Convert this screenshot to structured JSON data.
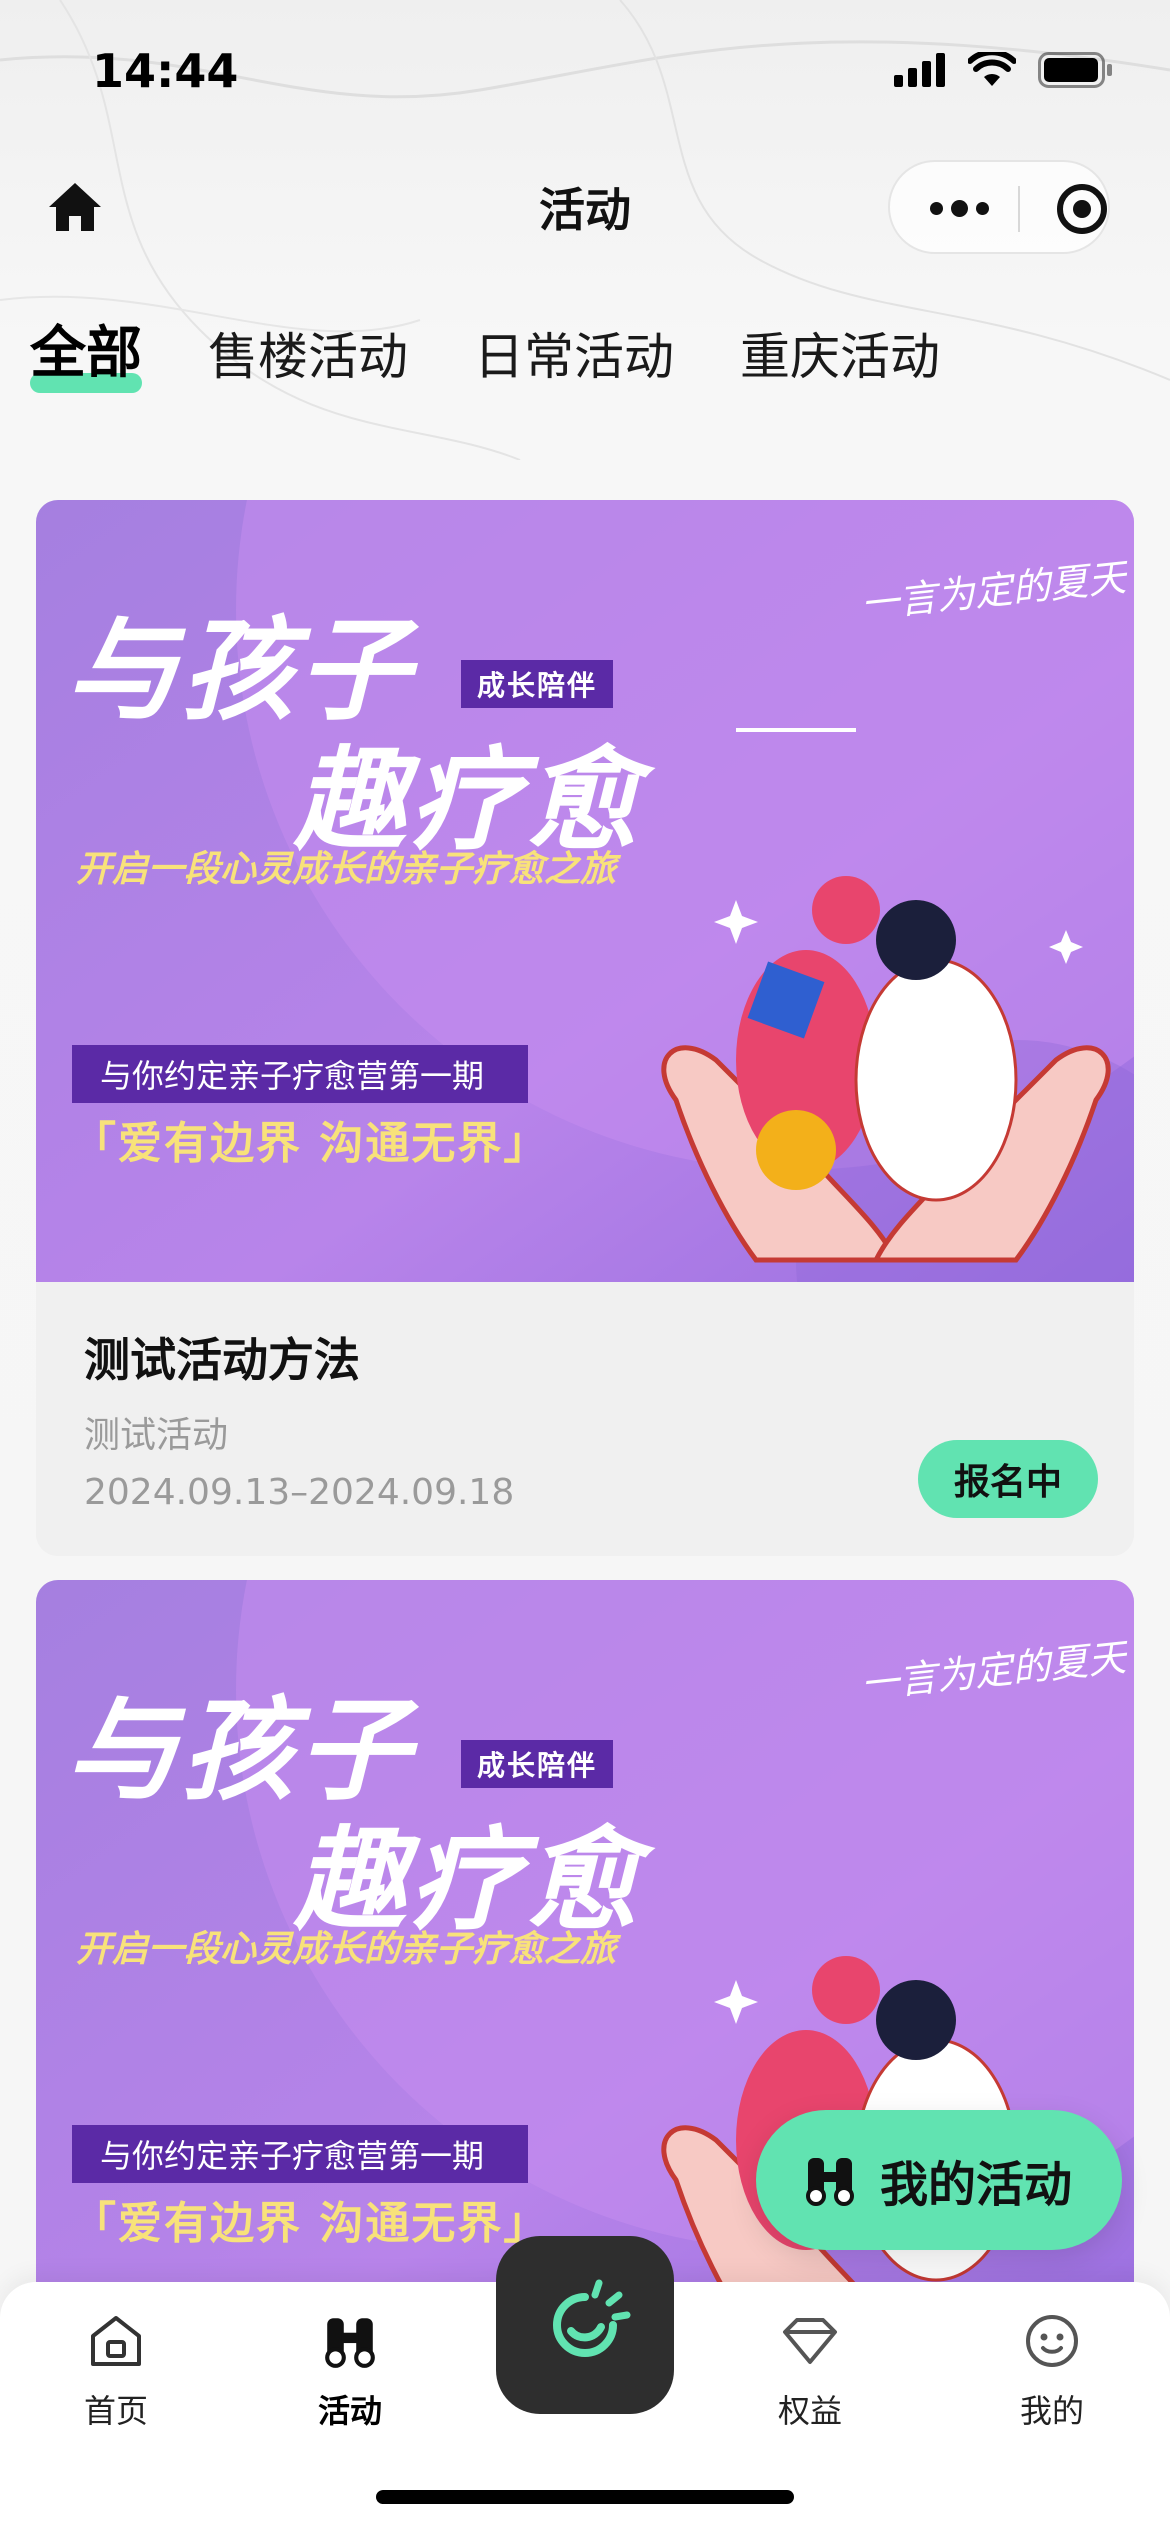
{
  "status_bar": {
    "time": "14:44"
  },
  "nav": {
    "title": "活动"
  },
  "tabs": [
    {
      "label": "全部",
      "active": true
    },
    {
      "label": "售楼活动",
      "active": false
    },
    {
      "label": "日常活动",
      "active": false
    },
    {
      "label": "重庆活动",
      "active": false
    }
  ],
  "banner": {
    "headline_1": "与孩子",
    "badge": "成长陪伴",
    "headline_2": "趣疗愈",
    "slogan": "开启一段心灵成长的亲子疗愈之旅",
    "camp": "与你约定亲子疗愈营第一期",
    "quote": "「爱有边界 沟通无界」",
    "signature": "一言为定的夏天"
  },
  "cards": [
    {
      "title": "测试活动方法",
      "subtitle": "测试活动",
      "date_range": "2024.09.13–2024.09.18",
      "status": "报名中"
    }
  ],
  "fab": {
    "label": "我的活动"
  },
  "tabbar": {
    "items": [
      {
        "label": "首页"
      },
      {
        "label": "活动"
      },
      {
        "label": "权益"
      },
      {
        "label": "我的"
      }
    ]
  },
  "colors": {
    "accent": "#61e3b1",
    "banner_purple": "#b57be8",
    "banner_deep": "#5b2aa6",
    "banner_yellow": "#f8e27a",
    "dark": "#2e2e2e"
  }
}
